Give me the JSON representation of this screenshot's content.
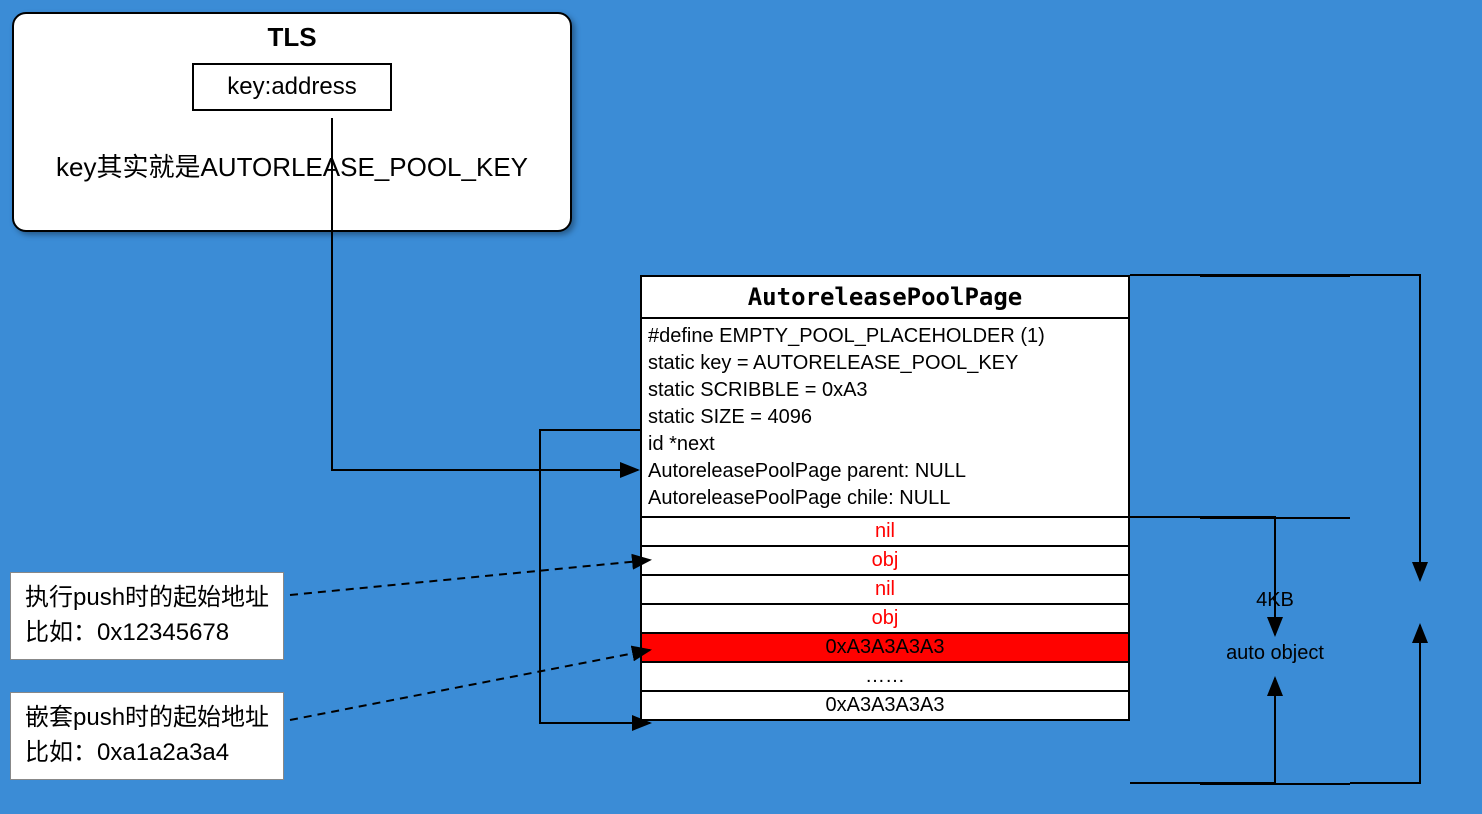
{
  "tls": {
    "title": "TLS",
    "key_label": "key:address",
    "note": "key其实就是AUTORLEASE_POOL_KEY"
  },
  "pool": {
    "title": "AutoreleasePoolPage",
    "meta": [
      "#define EMPTY_POOL_PLACEHOLDER (1)",
      "static key = AUTORELEASE_POOL_KEY",
      "static SCRIBBLE = 0xA3",
      "static SIZE = 4096",
      "id *next",
      "AutoreleasePoolPage parent: NULL",
      "AutoreleasePoolPage chile: NULL"
    ],
    "rows": [
      {
        "text": "nil",
        "red_text": true
      },
      {
        "text": "obj",
        "red_text": true
      },
      {
        "text": "nil",
        "red_text": true
      },
      {
        "text": "obj",
        "red_text": true
      },
      {
        "text": "0xA3A3A3A3",
        "red_bg": true
      },
      {
        "text": "……"
      },
      {
        "text": "0xA3A3A3A3"
      }
    ]
  },
  "labels": {
    "push_start": {
      "line1": "执行push时的起始地址",
      "line2": "比如：0x12345678"
    },
    "nested_push": {
      "line1": "嵌套push时的起始地址",
      "line2": "比如：0xa1a2a3a4"
    }
  },
  "size_labels": {
    "auto_object": "auto object",
    "total": "4KB"
  }
}
